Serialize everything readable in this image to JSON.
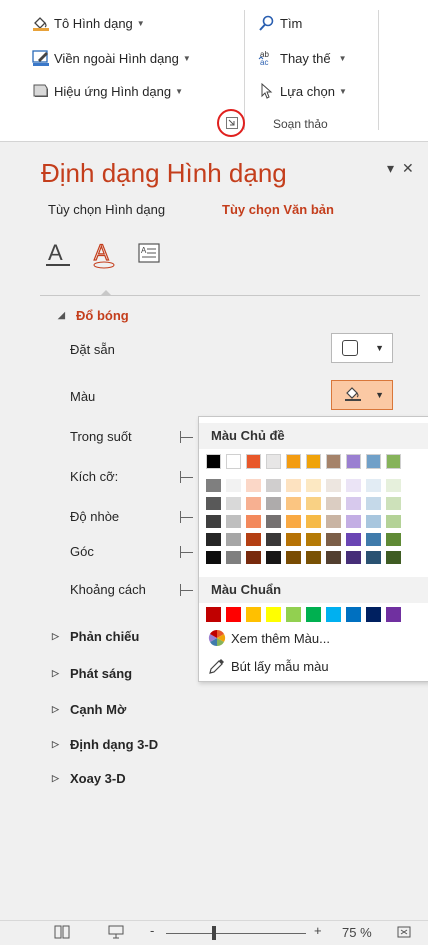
{
  "ribbon": {
    "shape_fill": "Tô Hình dạng",
    "shape_outline": "Viền ngoài Hình dạng",
    "shape_effects": "Hiệu ứng Hình dạng",
    "find": "Tìm",
    "replace": "Thay thế",
    "select": "Lựa chọn",
    "group_editing": "Soạn thảo"
  },
  "pane": {
    "title": "Định dạng Hình dạng",
    "tab_shape_options": "Tùy chọn Hình dạng",
    "tab_text_options": "Tùy chọn Văn bản",
    "shadow": {
      "header": "Đổ bóng",
      "presets": "Đặt sẵn",
      "color": "Màu",
      "transparency": "Trong suốt",
      "size": "Kích cỡ:",
      "blur": "Độ nhòe",
      "angle": "Góc",
      "distance": "Khoảng cách"
    },
    "sections": [
      "Phản chiếu",
      "Phát sáng",
      "Cạnh Mờ",
      "Định dạng 3-D",
      "Xoay 3-D"
    ]
  },
  "color_dropdown": {
    "theme_colors_label": "Màu Chủ đề",
    "standard_colors_label": "Màu Chuẩn",
    "more_colors": "Xem thêm Màu...",
    "eyedropper": "Bút lấy mẫu màu",
    "theme_colors": [
      "#000000",
      "#ffffff",
      "#e8582a",
      "#e7e6e6",
      "#f39c12",
      "#f0a30a",
      "#a5836a",
      "#9a7fd1",
      "#70a0c8",
      "#86b35a"
    ],
    "theme_shades": [
      [
        "#7f7f7f",
        "#595959",
        "#3f3f3f",
        "#262626",
        "#0d0d0d"
      ],
      [
        "#f2f2f2",
        "#d9d9d9",
        "#bfbfbf",
        "#a6a6a6",
        "#7f7f7f"
      ],
      [
        "#fbd7c7",
        "#f7b091",
        "#f3895c",
        "#b43f13",
        "#782a0d"
      ],
      [
        "#d0cece",
        "#aeabab",
        "#757171",
        "#3a3838",
        "#171616"
      ],
      [
        "#fde2c0",
        "#fbc581",
        "#f9a943",
        "#b67205",
        "#794c03"
      ],
      [
        "#fce8c2",
        "#f9d184",
        "#f6ba47",
        "#b57a06",
        "#795104"
      ],
      [
        "#ede6e0",
        "#dbcdc2",
        "#c9b4a3",
        "#7b5e48",
        "#523f30"
      ],
      [
        "#ebe4f6",
        "#d7c9ed",
        "#c3aee4",
        "#6a45b4",
        "#462e78"
      ],
      [
        "#e2ecf4",
        "#c5d9e9",
        "#a8c6de",
        "#3f7bab",
        "#2a5272"
      ],
      [
        "#e6f0dc",
        "#cde1ba",
        "#b4d297",
        "#5f8a35",
        "#3f5c23"
      ]
    ],
    "standard_colors": [
      "#c00000",
      "#ff0000",
      "#ffc000",
      "#ffff00",
      "#92d050",
      "#00b050",
      "#00b0f0",
      "#0070c0",
      "#002060",
      "#7030a0"
    ]
  },
  "statusbar": {
    "zoom": "75 %",
    "minus": "-",
    "plus": "+"
  }
}
